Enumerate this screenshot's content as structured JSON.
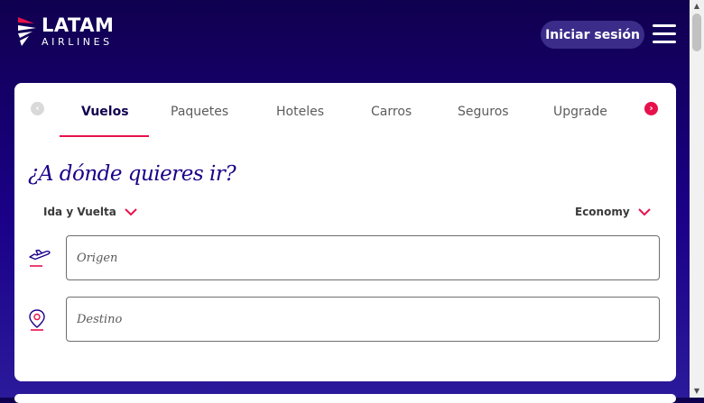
{
  "header": {
    "logo_primary": "LATAM",
    "logo_secondary": "AIRLINES",
    "login_label": "Iniciar sesión",
    "menu_icon": "hamburger-menu-icon"
  },
  "tabs": [
    {
      "label": "Vuelos",
      "active": true
    },
    {
      "label": "Paquetes",
      "active": false
    },
    {
      "label": "Hoteles",
      "active": false
    },
    {
      "label": "Carros",
      "active": false
    },
    {
      "label": "Seguros",
      "active": false
    },
    {
      "label": "Upgrade",
      "active": false
    }
  ],
  "search": {
    "heading": "¿A dónde quieres ir?",
    "trip_type": "Ida y Vuelta",
    "cabin_class": "Economy",
    "origin_placeholder": "Origen",
    "destination_placeholder": "Destino"
  },
  "colors": {
    "brand_navy": "#1b0088",
    "brand_accent": "#e8114b",
    "header_bg": "#10004f"
  }
}
